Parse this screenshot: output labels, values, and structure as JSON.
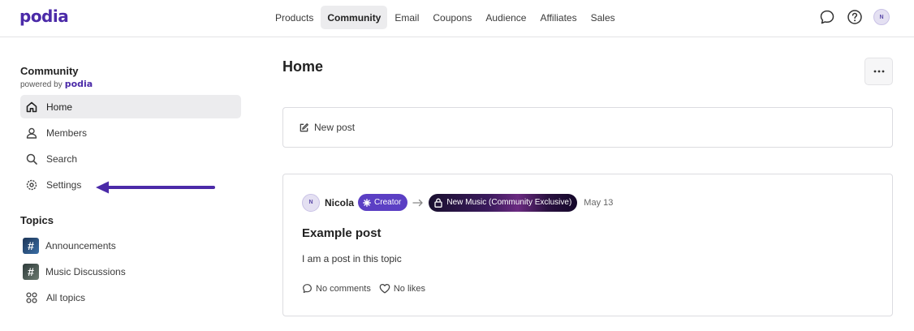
{
  "header": {
    "logo": "podia",
    "nav": [
      "Products",
      "Community",
      "Email",
      "Coupons",
      "Audience",
      "Affiliates",
      "Sales"
    ],
    "active_nav": "Community",
    "avatar_initial": "N"
  },
  "sidebar": {
    "title": "Community",
    "powered_by": "powered by",
    "powered_logo": "podia",
    "items": [
      {
        "label": "Home",
        "icon": "home-icon",
        "active": true
      },
      {
        "label": "Members",
        "icon": "user-icon"
      },
      {
        "label": "Search",
        "icon": "search-icon"
      },
      {
        "label": "Settings",
        "icon": "gear-icon"
      }
    ],
    "topics_title": "Topics",
    "topics": [
      {
        "label": "Announcements",
        "icon": "hash-thumbnail"
      },
      {
        "label": "Music Discussions",
        "icon": "hash-thumbnail"
      },
      {
        "label": "All topics",
        "icon": "grid-icon"
      }
    ]
  },
  "main": {
    "title": "Home",
    "new_post_label": "New post",
    "post": {
      "avatar_initial": "N",
      "author": "Nicola",
      "role_badge": "Creator",
      "topic_badge": "New Music (Community Exclusive)",
      "date": "May 13",
      "title": "Example post",
      "body": "I am a post in this topic",
      "comments_label": "No comments",
      "likes_label": "No likes"
    }
  },
  "colors": {
    "brand": "#4b2aa8",
    "creator_badge": "#5b3fc4",
    "annotation_arrow": "#4b2aa8",
    "active_bg": "#ececee"
  }
}
